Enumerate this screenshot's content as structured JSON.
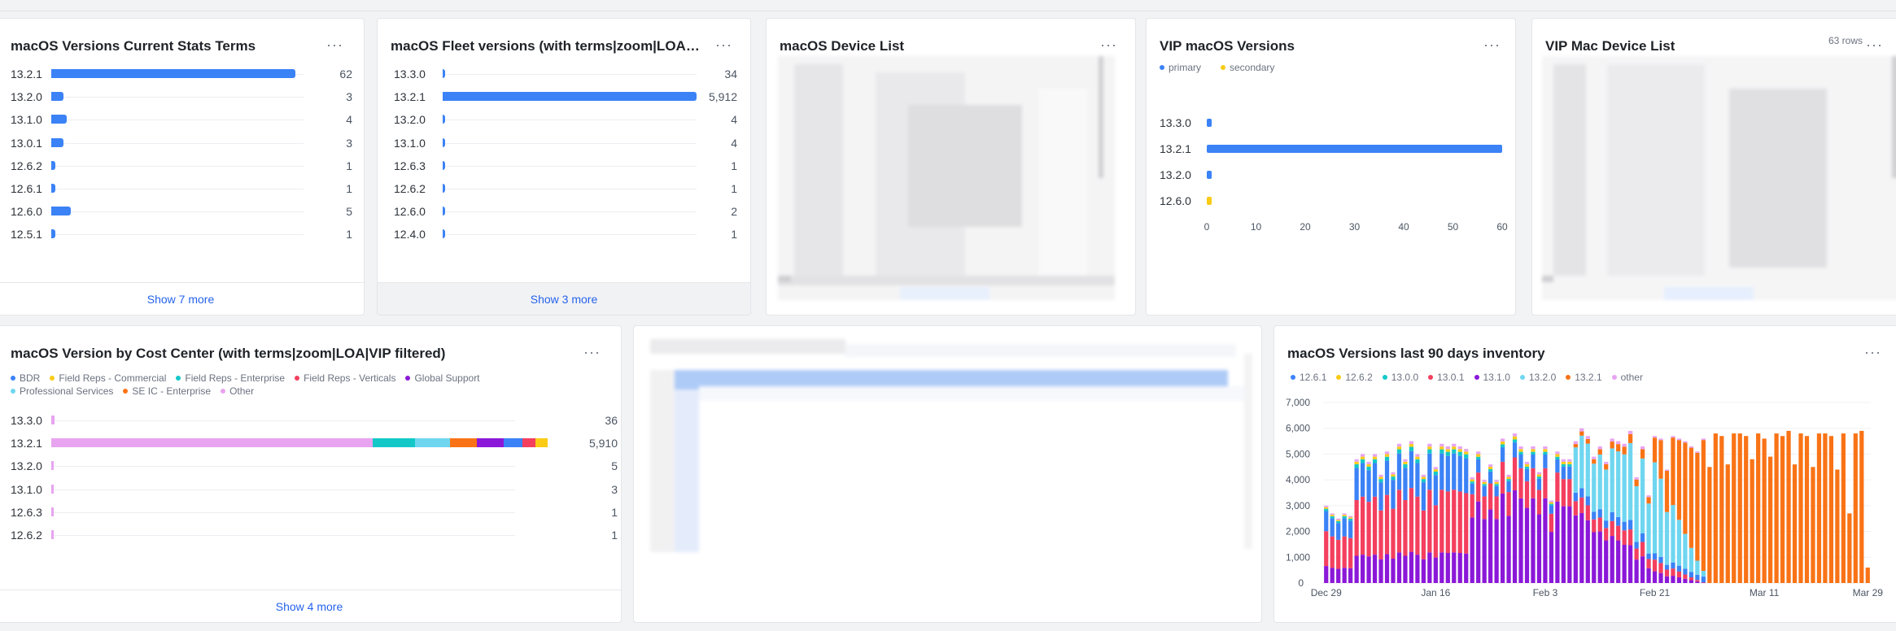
{
  "colors": {
    "bar_blue": "#3b82f6",
    "link": "#2563eb",
    "primary": "#3b82f6",
    "secondary": "#facc15"
  },
  "icons": {
    "menu": "ellipsis-icon"
  },
  "cards": {
    "current_stats": {
      "title": "macOS Versions Current Stats Terms",
      "menu": "···",
      "show_more": "Show 7 more"
    },
    "fleet_versions": {
      "title": "macOS Fleet versions (with terms|zoom|LOA|VIP filtered)",
      "menu": "···",
      "show_more": "Show 3 more"
    },
    "device_list": {
      "title": "macOS Device List",
      "menu": "···"
    },
    "vip_versions": {
      "title": "VIP macOS Versions",
      "menu": "···"
    },
    "vip_device_list": {
      "title": "VIP Mac Device List",
      "rows": "63 rows",
      "menu": "···"
    },
    "cost_center": {
      "title": "macOS Version by Cost Center (with terms|zoom|LOA|VIP filtered)",
      "menu": "···",
      "show_more": "Show 4 more"
    },
    "inventory": {
      "title": "macOS Versions last 90 days inventory",
      "menu": "···"
    }
  },
  "chart_data": [
    {
      "id": "current_stats",
      "type": "bar",
      "orientation": "horizontal",
      "categories": [
        "13.2.1",
        "13.2.0",
        "13.1.0",
        "13.0.1",
        "12.6.2",
        "12.6.1",
        "12.6.0",
        "12.5.1"
      ],
      "values": [
        62,
        3,
        4,
        3,
        1,
        1,
        5,
        1
      ],
      "value_labels": [
        "62",
        "3",
        "4",
        "3",
        "1",
        "1",
        "5",
        "1"
      ],
      "title": "macOS Versions Current Stats Terms",
      "xlim": [
        0,
        64
      ]
    },
    {
      "id": "fleet_versions",
      "type": "bar",
      "orientation": "horizontal",
      "categories": [
        "13.3.0",
        "13.2.1",
        "13.2.0",
        "13.1.0",
        "12.6.3",
        "12.6.2",
        "12.6.0",
        "12.4.0"
      ],
      "values": [
        34,
        5912,
        4,
        4,
        1,
        1,
        2,
        1
      ],
      "value_labels": [
        "34",
        "5,912",
        "4",
        "4",
        "1",
        "1",
        "2",
        "1"
      ],
      "title": "macOS Fleet versions (with terms|zoom|LOA|VIP filtered)",
      "xlim": [
        0,
        5912
      ]
    },
    {
      "id": "vip_versions",
      "type": "bar",
      "orientation": "horizontal",
      "title": "VIP macOS Versions",
      "categories": [
        "13.3.0",
        "13.2.1",
        "13.2.0",
        "12.6.0"
      ],
      "series": [
        {
          "name": "primary",
          "color": "#3b82f6",
          "values": [
            1,
            60,
            1,
            0
          ]
        },
        {
          "name": "secondary",
          "color": "#facc15",
          "values": [
            0,
            0,
            0,
            1
          ]
        }
      ],
      "xlim": [
        0,
        60
      ],
      "xticks": [
        "0",
        "10",
        "20",
        "30",
        "40",
        "50",
        "60"
      ],
      "legend": "top-left"
    },
    {
      "id": "cost_center",
      "type": "bar",
      "orientation": "horizontal",
      "stacked": true,
      "title": "macOS Version by Cost Center (with terms|zoom|LOA|VIP filtered)",
      "categories": [
        "13.3.0",
        "13.2.1",
        "13.2.0",
        "13.1.0",
        "12.6.3",
        "12.6.2"
      ],
      "totals": [
        "36",
        "5,910",
        "5",
        "3",
        "1",
        "1"
      ],
      "series": [
        {
          "name": "BDR",
          "color": "#3b82f6",
          "values": [
            0,
            220,
            0,
            0,
            0,
            0
          ]
        },
        {
          "name": "Field Reps - Commercial",
          "color": "#facc15",
          "values": [
            0,
            150,
            0,
            0,
            0,
            0
          ]
        },
        {
          "name": "Field Reps - Enterprise",
          "color": "#14c8c8",
          "values": [
            0,
            500,
            0,
            0,
            0,
            0
          ]
        },
        {
          "name": "Field Reps - Verticals",
          "color": "#f43f5e",
          "values": [
            0,
            150,
            0,
            0,
            0,
            0
          ]
        },
        {
          "name": "Global Support",
          "color": "#8b18d8",
          "values": [
            0,
            320,
            0,
            0,
            0,
            0
          ]
        },
        {
          "name": "Professional Services",
          "color": "#6fd6f0",
          "values": [
            0,
            420,
            0,
            0,
            0,
            0
          ]
        },
        {
          "name": "SE IC - Enterprise",
          "color": "#f97316",
          "values": [
            0,
            320,
            0,
            0,
            0,
            0
          ]
        },
        {
          "name": "Other",
          "color": "#e8a4f0",
          "values": [
            36,
            3830,
            5,
            3,
            1,
            1
          ]
        }
      ],
      "xlim": [
        0,
        6200
      ],
      "legend": "top-left"
    },
    {
      "id": "inventory",
      "type": "bar",
      "stacked": true,
      "title": "macOS Versions last 90 days inventory",
      "series_names": [
        "12.6.1",
        "12.6.2",
        "13.0.0",
        "13.0.1",
        "13.1.0",
        "13.2.0",
        "13.2.1",
        "other"
      ],
      "series_colors": [
        "#3b82f6",
        "#facc15",
        "#14c8c8",
        "#f43f5e",
        "#8b18d8",
        "#6fd6f0",
        "#f97316",
        "#e8a4f0"
      ],
      "x_ticks": [
        "Dec 29",
        "Jan 16",
        "Feb 3",
        "Feb 21",
        "Mar 11",
        "Mar 29"
      ],
      "y_ticks": [
        "0",
        "1,000",
        "2,000",
        "3,000",
        "4,000",
        "5,000",
        "6,000",
        "7,000"
      ],
      "ylim": [
        0,
        7000
      ],
      "n_days": 90,
      "totals": [
        3000,
        2700,
        2500,
        2700,
        2600,
        4800,
        5000,
        4700,
        5000,
        4200,
        5100,
        4300,
        5400,
        4800,
        5500,
        5000,
        4200,
        5400,
        4500,
        5400,
        5300,
        5400,
        5300,
        5200,
        4100,
        5100,
        4000,
        4600,
        4000,
        5600,
        4200,
        5800,
        5300,
        4700,
        5300,
        4300,
        5300,
        3200,
        5100,
        4800,
        4800,
        5500,
        6000,
        5700,
        4900,
        5300,
        4700,
        5600,
        5500,
        5400,
        5900,
        4100,
        5300,
        3400,
        5700,
        5600,
        4400,
        5700,
        5600,
        5500,
        5300,
        5100,
        5600,
        4500,
        5800,
        5700,
        4600,
        5800,
        5800,
        5700,
        4800,
        5800,
        5600,
        4900,
        5800,
        5700,
        5900,
        4600,
        5800,
        5700,
        4500,
        5800,
        5800,
        5700,
        4400,
        5800,
        2700,
        5800,
        5900,
        600
      ],
      "legend": "top-left"
    }
  ]
}
